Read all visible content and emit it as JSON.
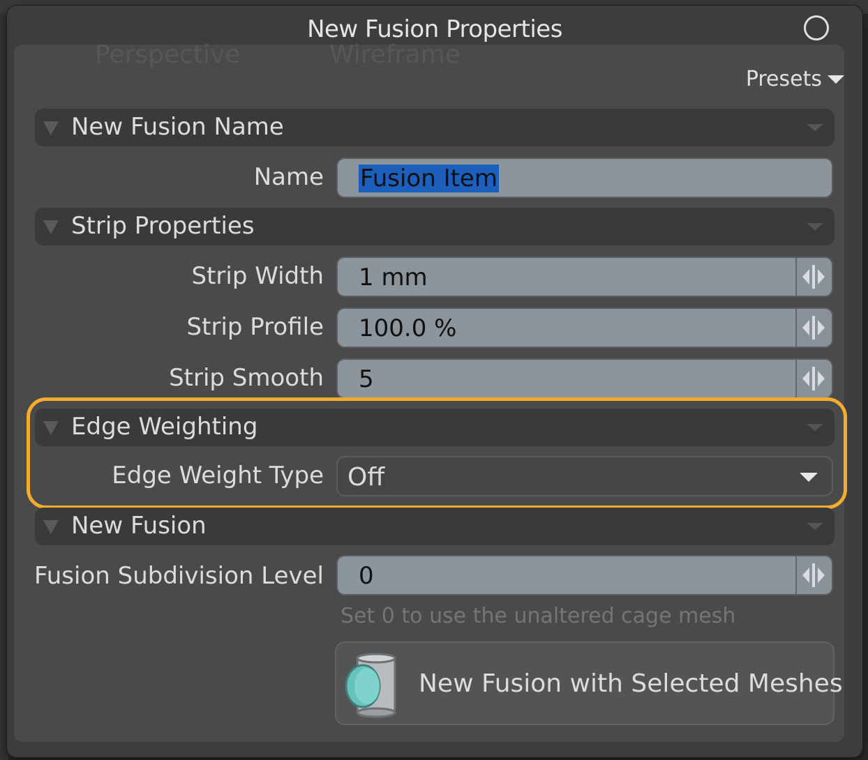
{
  "background": {
    "viewport_label": "Perspective",
    "shading_label": "Wireframe"
  },
  "dialog": {
    "title": "New Fusion Properties",
    "close_icon": "circle-close-icon",
    "presets_label": "Presets"
  },
  "sections": {
    "name_section": "New Fusion Name",
    "strip_section": "Strip Properties",
    "edge_section": "Edge Weighting",
    "fusion_section": "New Fusion"
  },
  "fields": {
    "name": {
      "label": "Name",
      "value": "Fusion Item"
    },
    "strip_width": {
      "label": "Strip Width",
      "value": "1 mm"
    },
    "strip_profile": {
      "label": "Strip Profile",
      "value": "100.0 %"
    },
    "strip_smooth": {
      "label": "Strip Smooth",
      "value": "5"
    },
    "edge_weight_type": {
      "label": "Edge Weight Type",
      "value": "Off"
    },
    "fusion_subdivision": {
      "label": "Fusion Subdivision Level",
      "value": "0"
    }
  },
  "hint": "Set 0 to use the unaltered cage mesh",
  "action_button": {
    "label": "New Fusion with Selected Meshes",
    "icon": "fusion-cylinder-icon"
  },
  "colors": {
    "highlight": "#f4ac2c",
    "selection": "#1c5fbd",
    "field_bg": "#8c949c"
  }
}
